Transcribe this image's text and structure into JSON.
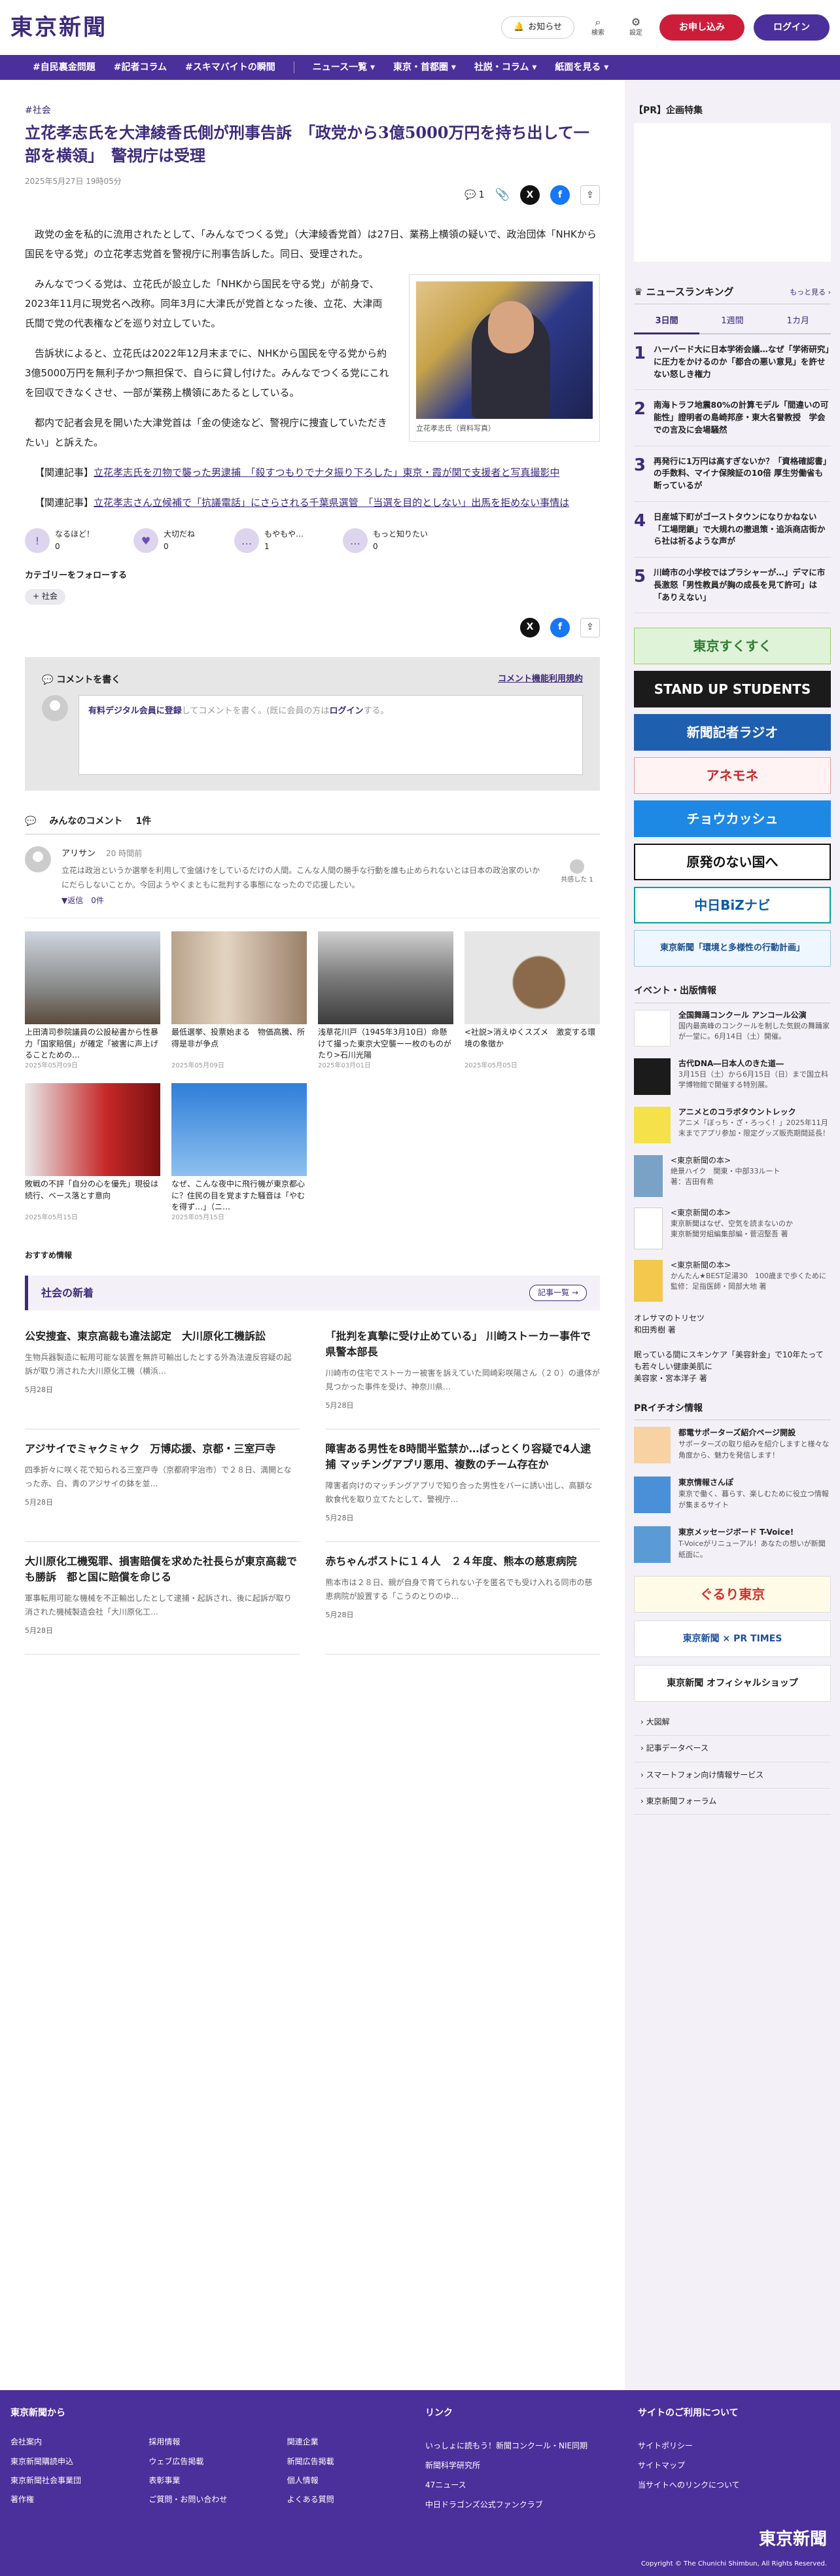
{
  "header": {
    "logo": "東京新聞",
    "notice": "お知らせ",
    "search": "検索",
    "settings": "設定",
    "subscribe": "お申し込み",
    "login": "ログイン"
  },
  "nav": [
    "#自民裏金問題",
    "#記者コラム",
    "#スキマバイトの瞬間",
    "ニュース一覧 ▾",
    "東京・首都圏 ▾",
    "社説・コラム ▾",
    "紙面を見る ▾"
  ],
  "article": {
    "tag": "#社会",
    "title": "立花孝志氏を大津綾香氏側が刑事告訴　「政党から3億5000万円を持ち出して一部を横領」　警視庁は受理",
    "date": "2025年5月27日 19時05分",
    "comment_count": "1",
    "paragraphs": [
      "政党の金を私的に流用されたとして、「みんなでつくる党」（大津綾香党首）は27日、業務上横領の疑いで、政治団体「NHKから国民を守る党」の立花孝志党首を警視庁に刑事告訴した。同日、受理された。",
      "みんなでつくる党は、立花氏が設立した「NHKから国民を守る党」が前身で、2023年11月に現党名へ改称。同年3月に大津氏が党首となった後、立花、大津両氏間で党の代表権などを巡り対立していた。",
      "告訴状によると、立花氏は2022年12月末までに、NHKから国民を守る党から約3億5000万円を無利子かつ無担保で、自らに貸し付けた。みんなでつくる党にこれを回収できなくさせ、一部が業務上横領にあたるとしている。",
      "都内で記者会見を開いた大津党首は「金の使途など、警視庁に捜査していただきたい」と訴えた。"
    ],
    "photo_caption": "立花孝志氏（資料写真）",
    "related": [
      {
        "prefix": "【関連記事】",
        "text": "立花孝志氏を刃物で襲った男逮捕　「殺すつもりでナタ振り下ろした」東京・霞が関で支援者と写真撮影中"
      },
      {
        "prefix": "【関連記事】",
        "text": "立花孝志さん立候補で「抗議電話」にさらされる千葉県選管　「当選を目的としない」出馬を拒めない事情は"
      }
    ]
  },
  "reactions": [
    {
      "label": "なるほど！",
      "count": "0",
      "icon": "!"
    },
    {
      "label": "大切だね",
      "count": "0",
      "icon": "♥"
    },
    {
      "label": "もやもや…",
      "count": "1",
      "icon": "…"
    },
    {
      "label": "もっと知りたい",
      "count": "0",
      "icon": "…"
    }
  ],
  "follow": {
    "label": "カテゴリーをフォローする",
    "chip": "+ 社会"
  },
  "comment_form": {
    "title": "コメントを書く",
    "terms": "コメント機能利用規約",
    "member_link": "有料デジタル会員に登録",
    "placeholder_mid": "してコメントを書く。(既に会員の方は",
    "login": "ログイン",
    "placeholder_end": "する。"
  },
  "comments": {
    "header": "みんなのコメント",
    "count": "1件",
    "items": [
      {
        "name": "アリサン",
        "ago": "20 時間前",
        "text": "立花は政治というか選挙を利用して金儲けをしているだけの人間。こんな人間の勝手な行動を誰も止められないとは日本の政治家のいかにだらしないことか。今回ようやくまともに批判する事態になったので応援したい。",
        "reply": "▼返信　0件",
        "agree": "共感した 1"
      }
    ]
  },
  "thumbs": [
    {
      "caption": "上田清司参院議員の公設秘書から性暴力「国家賠償」が確定「被害に声上げることための…",
      "date": "2025年05月09日"
    },
    {
      "caption": "最低選挙、投票始まる　物価高騰、所得是非が争点",
      "date": "2025年05月09日"
    },
    {
      "caption": "浅草花川戸（1945年3月10日）命懸けて撮った東京大空襲ーー枚のものがたり>石川光陽",
      "date": "2025年03月01日"
    },
    {
      "caption": "<社説>消えゆくスズメ　激変する環境の象徴か",
      "date": "2025年05月05日"
    },
    {
      "caption": "敗戦の不評「自分の心を優先」現役は続行、ベース落とす意向",
      "date": "2025年05月15日"
    },
    {
      "caption": "なぜ、こんな夜中に飛行機が東京都心に？住民の目を覚ますた騒音は「やむを得ず…」（ニ…",
      "date": "2025年05月15日"
    }
  ],
  "recommend": "おすすめ情報",
  "society": {
    "title": "社会の新着",
    "more": "記事一覧 →",
    "items": [
      {
        "title": "公安捜査、東京高裁も違法認定　大川原化工機訴訟",
        "text": "生物兵器製造に転用可能な装置を無許可輸出したとする外為法違反容疑の起訴が取り消された大川原化工機（横浜…",
        "date": "5月28日"
      },
      {
        "title": "「批判を真摯に受け止めている」 川崎ストーカー事件で県警本部長",
        "text": "川崎市の住宅でストーカー被害を訴えていた岡崎彩咲陽さん（２０）の遺体が見つかった事件を受け、神奈川県…",
        "date": "5月28日"
      },
      {
        "title": "アジサイでミャクミャク　万博応援、京都・三室戸寺",
        "text": "四季折々に咲く花で知られる三室戸寺（京都府宇治市）で２８日、満開となった赤、白、青のアジサイの鉢を並…",
        "date": "5月28日"
      },
      {
        "title": "障害ある男性を8時間半監禁か…ぱっとくり容疑で4人逮捕 マッチングアプリ悪用、複数のチーム存在か",
        "text": "障害者向けのマッチングアプリで知り合った男性をバーに誘い出し、高額な飲食代を取り立てたとして、警視庁…",
        "date": "5月28日"
      },
      {
        "title": "大川原化工機冤罪、損害賠償を求めた社長らが東京高裁でも勝訴　都と国に賠償を命じる",
        "text": "軍事転用可能な機械を不正輸出したとして逮捕・起訴され、後に起訴が取り消された機械製造会社「大川原化工…",
        "date": "5月28日"
      },
      {
        "title": "赤ちゃんポストに１４人　２４年度、熊本の慈恵病院",
        "text": "熊本市は２８日、親が自身で育てられない子を匿名でも受け入れる同市の慈恵病院が設置する「こうのとりのゆ…",
        "date": "5月28日"
      }
    ]
  },
  "side": {
    "pr_title": "【PR】企画特集",
    "ranking": {
      "title": "ニュースランキング",
      "more": "もっと見る ›",
      "tabs": [
        "3日間",
        "1週間",
        "1カ月"
      ],
      "items": [
        {
          "n": "1",
          "t": "ハーバード大に日本学術会議…なぜ「学術研究」に圧力をかけるのか「都合の悪い意見」を許せない怒しき権力"
        },
        {
          "n": "2",
          "t": "南海トラフ地震80%の計算モデル「間違いの可能性」證明者の島崎邦彦・東大名誉教授　学会での言及に会場騒然"
        },
        {
          "n": "3",
          "t": "再発行に1万円は高すぎないか？「資格確認書」の手数料、マイナ保険証の10倍 厚生労働省も断っているが"
        },
        {
          "n": "4",
          "t": "日産城下町がゴーストタウンになりかねない「工場閉鎖」で大規れの撤退策・追浜商店街から社は祈るような声が"
        },
        {
          "n": "5",
          "t": "川崎市の小学校ではプラシャーが…」デマに市長激怒「男性教員が胸の成長を見て許可」は「ありえない」"
        }
      ]
    },
    "banners": [
      "東京すくすく",
      "STAND UP STUDENTS",
      "新聞記者ラジオ",
      "アネモネ",
      "チョウカッシュ",
      "原発のない国へ",
      "中日BiZナビ",
      "東京新聞「環境と多様性の行動計画」"
    ],
    "events_title": "イベント・出版情報",
    "events": [
      {
        "t": "全国舞踊コンクール アンコール公演",
        "s": "国内最高峰のコンクールを制した気鋭の舞踊家が一堂に。6月14日（土）開催。"
      },
      {
        "t": "古代DNA―日本人のきた道―",
        "s": "3月15日（土）から6月15日（日）まで国立科学博物館で開催する特別展。"
      },
      {
        "t": "アニメとのコラボタウントレック",
        "s": "アニメ「ぼっち・ざ・ろっく！」2025年11月末までアプリ参加・限定グッズ販売期間延長！"
      }
    ],
    "books": [
      {
        "t": "<東京新聞の本>",
        "s": "絶景ハイク　関東・中部33ルート",
        "a": "著：吉田有希"
      },
      {
        "t": "<東京新聞の本>",
        "s": "東京新聞はなぜ、空気を読まないのか",
        "a": "東京新聞労組編集部編・菅沼堅吾 著"
      },
      {
        "t": "<東京新聞の本>",
        "s": "かんたん★BEST足湯30　100歳まで歩くために",
        "a": "監修：足指医師・岡部大地 著"
      }
    ],
    "small1": {
      "t": "オレサマのトリセツ",
      "s": "和田秀樹 著"
    },
    "small2": {
      "t": "眠っている間にスキンケア「美容針金」で10年たっても若々しい健康美肌に",
      "s": "美容家・宮本洋子 著"
    },
    "pr_info_title": "PRイチオシ情報",
    "pr_info": [
      {
        "t": "都電サポーターズ紹介ページ開設",
        "s": "サポーターズの取り組みを紹介しますと様々な角度から、魅力を発信します！"
      },
      {
        "t": "東京情報さんぽ",
        "s": "東京で働く、暮らす、楽しむために役立つ情報が集まるサイト"
      },
      {
        "t": "東京メッセージボード T-Voice!",
        "s": "T-Voiceがリニューアル！あなたの想いが新聞紙面に。"
      }
    ],
    "shop_banners": [
      "ぐるり東京",
      "東京新聞 × PR TIMES",
      "東京新聞 オフィシャルショップ"
    ],
    "links": [
      "大図解",
      "記事データベース",
      "スマートフォン向け情報サービス",
      "東京新聞フォーラム"
    ]
  },
  "footer": {
    "col1": {
      "title": "東京新聞から",
      "items": [
        "会社案内",
        "採用情報",
        "関連企業",
        "東京新聞購読申込",
        "ウェブ広告掲載",
        "新聞広告掲載",
        "東京新聞社会事業団",
        "表彰事業",
        "個人情報",
        "著作権",
        "ご質問・お問い合わせ",
        "よくある質問"
      ]
    },
    "col2": {
      "title": "リンク",
      "items": [
        "いっしょに読もう！新聞コンクール・NIE同期",
        "新聞科学研究所",
        "47ニュース",
        "中日ドラゴンズ公式ファンクラブ"
      ]
    },
    "col3": {
      "title": "サイトのご利用について",
      "items": [
        "サイトポリシー",
        "サイトマップ",
        "当サイトへのリンクについて"
      ]
    },
    "logo": "東京新聞",
    "copyright": "Copyright © The Chunichi Shimbun, All Rights Reserved."
  }
}
